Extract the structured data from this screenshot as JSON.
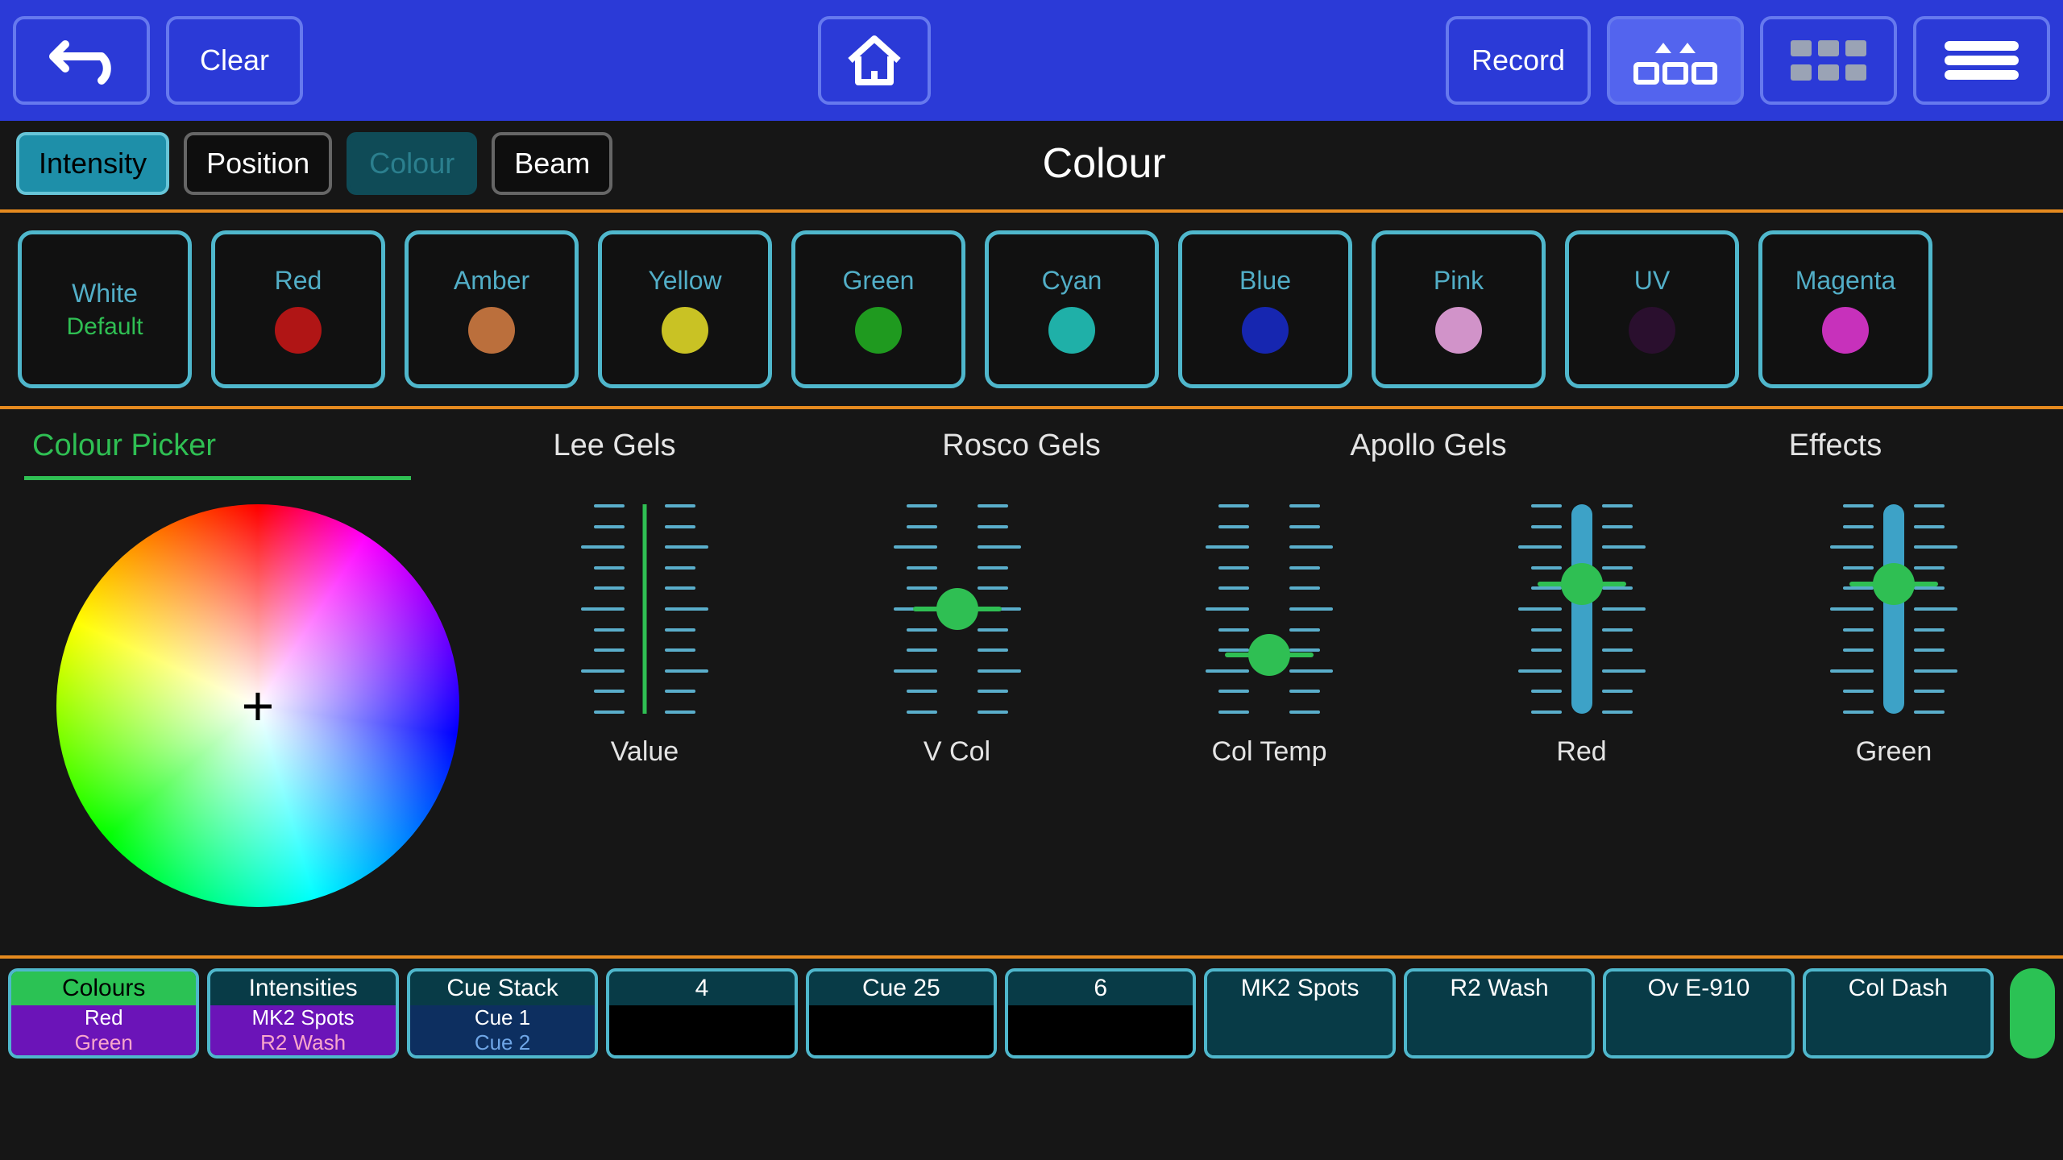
{
  "header": {
    "clear": "Clear",
    "record": "Record"
  },
  "attr_tabs": {
    "intensity": "Intensity",
    "position": "Position",
    "colour": "Colour",
    "beam": "Beam",
    "title": "Colour"
  },
  "presets": [
    {
      "label": "White",
      "sub": "Default",
      "swatch": null
    },
    {
      "label": "Red",
      "swatch": "#b01515"
    },
    {
      "label": "Amber",
      "swatch": "#bb6f3c"
    },
    {
      "label": "Yellow",
      "swatch": "#c9c224"
    },
    {
      "label": "Green",
      "swatch": "#1f9a1f"
    },
    {
      "label": "Cyan",
      "swatch": "#1fb0a8"
    },
    {
      "label": "Blue",
      "swatch": "#1626b0"
    },
    {
      "label": "Pink",
      "swatch": "#d193c9"
    },
    {
      "label": "UV",
      "swatch": "#2a0f2e"
    },
    {
      "label": "Magenta",
      "swatch": "#c731bb"
    }
  ],
  "picker_tabs": [
    "Colour Picker",
    "Lee Gels",
    "Rosco Gels",
    "Apollo Gels",
    "Effects"
  ],
  "picker_active": 0,
  "sliders": [
    {
      "name": "Value",
      "pos": 0.0,
      "fill_top": null,
      "fill_bottom": null,
      "line_only": true
    },
    {
      "name": "V Col",
      "pos": 0.5,
      "fill_top": null,
      "fill_bottom": null
    },
    {
      "name": "Col Temp",
      "pos": 0.72,
      "fill_top": null,
      "fill_bottom": null
    },
    {
      "name": "Red",
      "pos": 0.38,
      "fill_top": 0.0,
      "fill_bottom": 1.0
    },
    {
      "name": "Green",
      "pos": 0.38,
      "fill_top": 0.0,
      "fill_bottom": 1.0
    }
  ],
  "playbacks": [
    {
      "head": "Colours",
      "head_style": "green",
      "body_style": "purple",
      "lines": [
        "Red",
        "Green"
      ]
    },
    {
      "head": "Intensities",
      "head_style": "normal",
      "body_style": "purple",
      "lines": [
        "MK2 Spots",
        "R2 Wash"
      ]
    },
    {
      "head": "Cue Stack",
      "head_style": "normal",
      "body_style": "blue",
      "lines": [
        "Cue 1",
        "Cue 2"
      ]
    },
    {
      "head": "4",
      "head_style": "normal",
      "body_style": "black",
      "lines": []
    },
    {
      "head": "Cue 25",
      "head_style": "normal",
      "body_style": "black",
      "lines": []
    },
    {
      "head": "6",
      "head_style": "normal",
      "body_style": "black",
      "lines": []
    },
    {
      "head": "MK2 Spots",
      "head_style": "normal",
      "body_style": "teal",
      "lines": []
    },
    {
      "head": "R2 Wash",
      "head_style": "normal",
      "body_style": "teal",
      "lines": []
    },
    {
      "head": "Ov E-910",
      "head_style": "normal",
      "body_style": "teal",
      "lines": []
    },
    {
      "head": "Col Dash",
      "head_style": "normal",
      "body_style": "teal",
      "lines": []
    }
  ]
}
